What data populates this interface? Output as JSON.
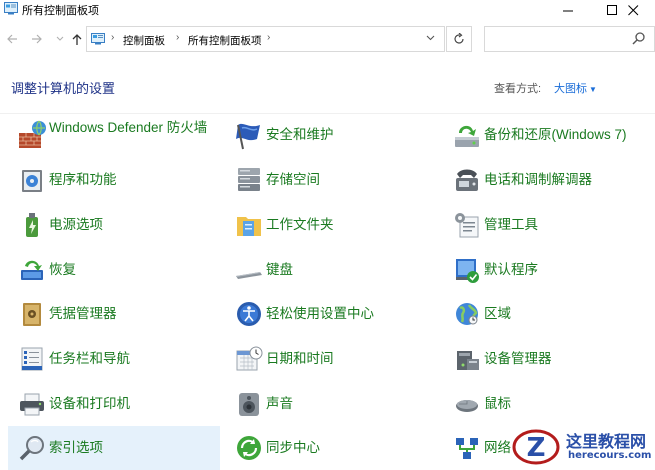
{
  "window": {
    "title": "所有控制面板项",
    "controls": {
      "minimize": "—",
      "maximize": "☐",
      "close": "✕"
    }
  },
  "nav": {
    "breadcrumbs": [
      "控制面板",
      "所有控制面板项"
    ],
    "search_placeholder": ""
  },
  "header": {
    "title": "调整计算机的设置",
    "view_by_label": "查看方式:",
    "view_mode": "大图标"
  },
  "items": [
    {
      "label": "Windows Defender 防火墙",
      "icon": "firewall-icon"
    },
    {
      "label": "安全和维护",
      "icon": "security-flag-icon"
    },
    {
      "label": "备份和还原(Windows 7)",
      "icon": "backup-icon"
    },
    {
      "label": "程序和功能",
      "icon": "programs-icon"
    },
    {
      "label": "存储空间",
      "icon": "storage-icon"
    },
    {
      "label": "电话和调制解调器",
      "icon": "phone-modem-icon"
    },
    {
      "label": "电源选项",
      "icon": "power-icon"
    },
    {
      "label": "工作文件夹",
      "icon": "work-folders-icon"
    },
    {
      "label": "管理工具",
      "icon": "admin-tools-icon"
    },
    {
      "label": "恢复",
      "icon": "recovery-icon"
    },
    {
      "label": "键盘",
      "icon": "keyboard-icon"
    },
    {
      "label": "默认程序",
      "icon": "default-programs-icon"
    },
    {
      "label": "凭据管理器",
      "icon": "credential-manager-icon"
    },
    {
      "label": "轻松使用设置中心",
      "icon": "ease-of-access-icon"
    },
    {
      "label": "区域",
      "icon": "region-globe-icon"
    },
    {
      "label": "任务栏和导航",
      "icon": "taskbar-icon"
    },
    {
      "label": "日期和时间",
      "icon": "date-time-icon"
    },
    {
      "label": "设备管理器",
      "icon": "device-manager-icon"
    },
    {
      "label": "设备和打印机",
      "icon": "printer-icon"
    },
    {
      "label": "声音",
      "icon": "sound-icon"
    },
    {
      "label": "鼠标",
      "icon": "mouse-icon"
    },
    {
      "label": "索引选项",
      "icon": "indexing-icon",
      "selected": true
    },
    {
      "label": "同步中心",
      "icon": "sync-center-icon"
    },
    {
      "label": "网络",
      "icon": "network-icon"
    }
  ],
  "watermark": {
    "line1": "这里教程网",
    "line2": "herecours.com",
    "logo_letter": "Z"
  },
  "colors": {
    "link_green": "#1a7a20",
    "heading_blue": "#1e3287",
    "selection": "#e5f1fb",
    "accent_blue": "#1a6dd8"
  }
}
